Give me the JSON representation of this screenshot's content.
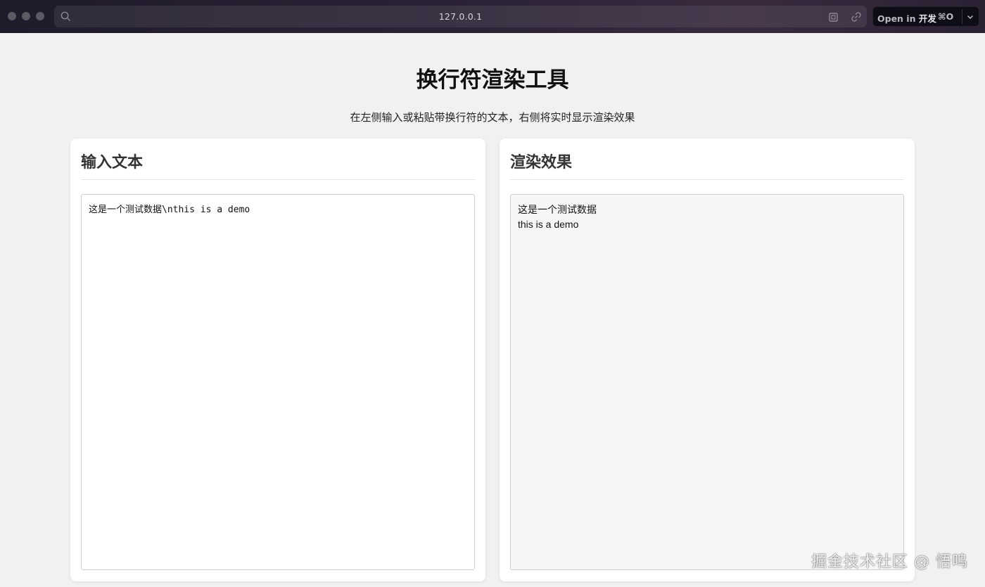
{
  "browser": {
    "url": "127.0.0.1",
    "open_in": {
      "prefix": "Open in",
      "app": "开发",
      "shortcut": "⌘O"
    },
    "icons": [
      "search-icon",
      "extension-icon",
      "link-icon",
      "chevron-down-icon"
    ]
  },
  "page": {
    "title": "换行符渲染工具",
    "subtitle": "在左侧输入或粘贴带换行符的文本，右侧将实时显示渲染效果"
  },
  "input_panel": {
    "heading": "输入文本",
    "value": "这是一个测试数据\\nthis is a demo"
  },
  "output_panel": {
    "heading": "渲染效果",
    "rendered": "这是一个测试数据\nthis is a demo"
  },
  "watermark": "掘金技术社区 @ 悟鸣"
}
